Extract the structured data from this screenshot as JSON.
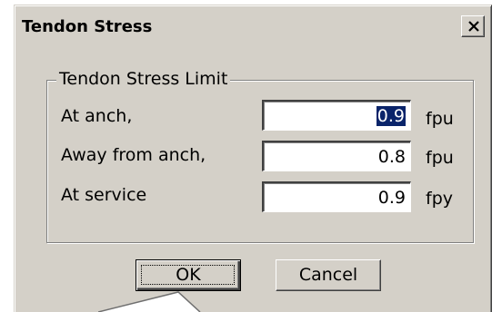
{
  "window": {
    "title": "Tendon Stress",
    "close_glyph": "×"
  },
  "group": {
    "legend": "Tendon Stress Limit",
    "rows": [
      {
        "label": "At anch,",
        "value": "0.9",
        "unit": "fpu",
        "selected": true
      },
      {
        "label": "Away from anch,",
        "value": "0.8",
        "unit": "fpu",
        "selected": false
      },
      {
        "label": "At service",
        "value": "0.9",
        "unit": "fpy",
        "selected": false
      }
    ]
  },
  "buttons": {
    "ok_label": "OK",
    "cancel_label": "Cancel"
  },
  "colors": {
    "dialog_face": "#d4d0c8",
    "selection": "#0a246a"
  },
  "icons": {
    "close": "close-icon",
    "pointer": "mouse-pointer-icon"
  }
}
